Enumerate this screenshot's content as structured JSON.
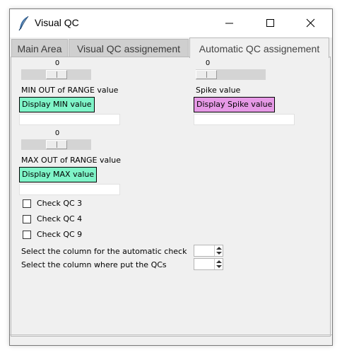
{
  "window": {
    "title": "Visual QC",
    "icon": "feather-icon",
    "controls": [
      "minimize-icon",
      "maximize-icon",
      "close-icon"
    ]
  },
  "tabs": [
    {
      "label": "Main Area",
      "active": false
    },
    {
      "label": "Visual QC assignement",
      "active": false
    },
    {
      "label": "Automatic QC assignement",
      "active": true
    }
  ],
  "min_section": {
    "scale_value": "0",
    "label": "MIN OUT of RANGE value",
    "button_label": "Display MIN value",
    "entry_value": ""
  },
  "max_section": {
    "scale_value": "0",
    "label": "MAX OUT of RANGE value",
    "button_label": "Display MAX value",
    "entry_value": ""
  },
  "spike_section": {
    "scale_value": "0",
    "label": "Spike value",
    "button_label": "Display Spike value",
    "entry_value": ""
  },
  "checks": [
    {
      "label": "Check QC 3",
      "checked": false
    },
    {
      "label": "Check QC 4",
      "checked": false
    },
    {
      "label": "Check QC 9",
      "checked": false
    }
  ],
  "column_selectors": [
    {
      "label": "Select the column for the automatic check",
      "value": ""
    },
    {
      "label": "Select the column where put the QCs",
      "value": ""
    }
  ],
  "colors": {
    "min_max_button": "#7ff4c8",
    "spike_button": "#e699e6",
    "background": "#f0f0f0"
  }
}
